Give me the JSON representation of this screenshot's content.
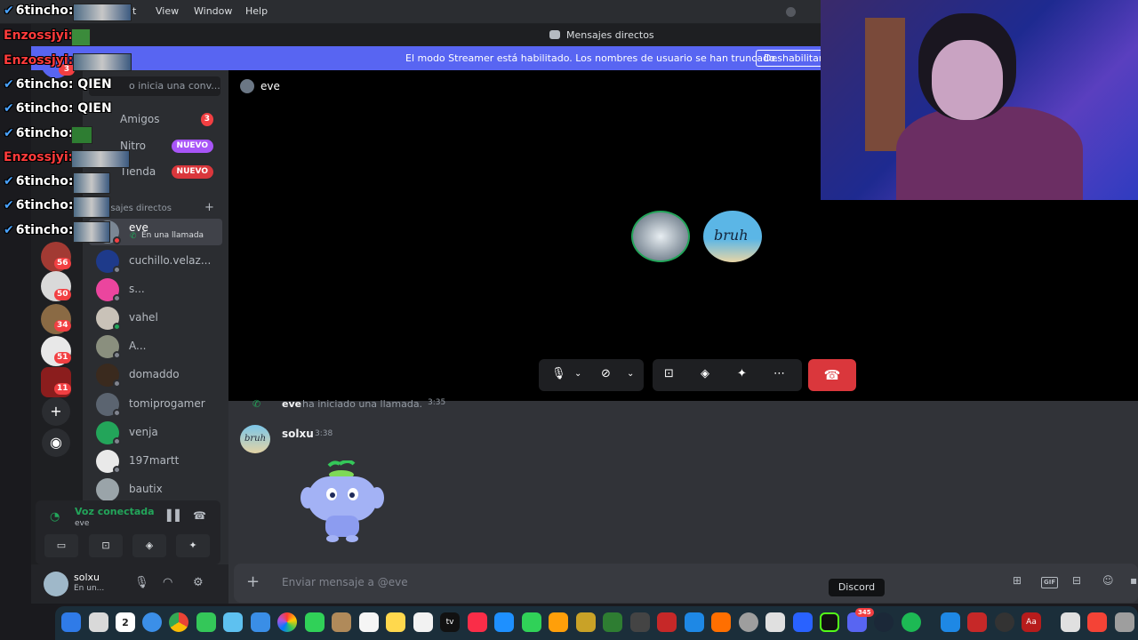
{
  "menubar": {
    "items": [
      "it",
      "View",
      "Window",
      "Help"
    ]
  },
  "window": {
    "title": "Mensajes directos"
  },
  "banner": {
    "text": "El modo Streamer está habilitado. Los nombres de usuario se han truncado.",
    "button": "Deshabilitar"
  },
  "sidebar": {
    "search_placeholder": "o inicia una conv...",
    "nav": [
      {
        "label": "Amigos",
        "badge": "3"
      },
      {
        "label": "Nitro",
        "badge": "NUEVO"
      },
      {
        "label": "Tienda",
        "badge": "NUEVO"
      }
    ],
    "dm_header": "nsajes directos",
    "dms": [
      {
        "name": "eve",
        "sub": "En una llamada"
      },
      {
        "name": "cuchillo.velaz..."
      },
      {
        "name": "s..."
      },
      {
        "name": "vahel"
      },
      {
        "name": "A..."
      },
      {
        "name": "domaddo"
      },
      {
        "name": "tomiprogamer"
      },
      {
        "name": "venja"
      },
      {
        "name": "197martt"
      },
      {
        "name": "bautix"
      }
    ]
  },
  "servers": {
    "badges": [
      "3",
      "56",
      "50",
      "34",
      "51",
      "11"
    ]
  },
  "voice": {
    "title": "Voz conectada",
    "channel": "eve"
  },
  "user": {
    "name": "solxu",
    "status": "En un..."
  },
  "call": {
    "user": "eve",
    "tile_label": "bruh"
  },
  "chat": {
    "system": {
      "who": "eve",
      "text": "ha iniciado una llamada.",
      "time": "3:35"
    },
    "message": {
      "author": "solxu",
      "time": "3:38",
      "avatar_text": "bruh"
    },
    "input_placeholder": "Enviar mensaje a @eve",
    "gif": "GIF"
  },
  "overlay": {
    "lines": [
      {
        "user": "6tincho:",
        "text": "",
        "color": "#ffffff"
      },
      {
        "user": "Enzossjyi:",
        "text": "",
        "color": "#ff3b3b"
      },
      {
        "user": "Enzossjyi:",
        "text": "",
        "color": "#ff3b3b"
      },
      {
        "user": "6tincho:",
        "text": "QIEN",
        "color": "#ffffff"
      },
      {
        "user": "6tincho:",
        "text": "QIEN",
        "color": "#ffffff"
      },
      {
        "user": "6tincho:",
        "text": "",
        "color": "#ffffff"
      },
      {
        "user": "Enzossjyi:",
        "text": "",
        "color": "#ff3b3b"
      },
      {
        "user": "6tincho:",
        "text": "",
        "color": "#ffffff"
      },
      {
        "user": "6tincho:",
        "text": "",
        "color": "#ffffff"
      },
      {
        "user": "6tincho:",
        "text": "",
        "color": "#ffffff"
      }
    ]
  },
  "dock": {
    "tooltip": "Discord",
    "calendar_day": "2",
    "mail_badge": "345"
  },
  "colors": {
    "blurple": "#5865f2",
    "online": "#23a55a",
    "danger": "#da373c",
    "badge": "#f23f42"
  }
}
